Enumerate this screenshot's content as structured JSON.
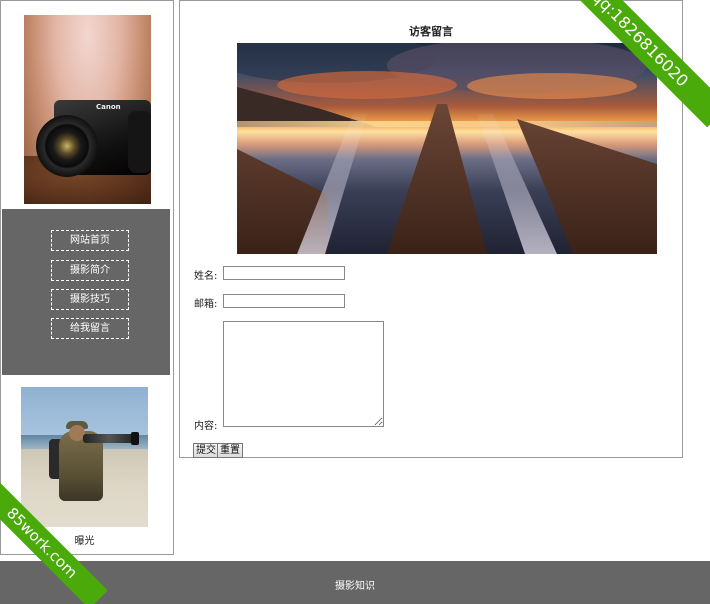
{
  "sidebar": {
    "nav": [
      {
        "label": "网站首页"
      },
      {
        "label": "摄影简介"
      },
      {
        "label": "摄影技巧"
      },
      {
        "label": "给我留言"
      }
    ],
    "camera_brand": "Canon",
    "photographer_caption": "曝光"
  },
  "main": {
    "title": "访客留言",
    "form": {
      "name_label": "姓名:",
      "email_label": "邮箱:",
      "content_label": "内容:",
      "name_value": "",
      "email_value": "",
      "content_value": "",
      "submit_label": "提交",
      "reset_label": "重置"
    }
  },
  "footer": {
    "text": "摄影知识"
  },
  "watermarks": {
    "top_right": "qq:1826816020",
    "bottom_left": "85work.com"
  },
  "colors": {
    "nav_background": "#666666",
    "footer_background": "#666666",
    "ribbon": "#4aaa0a"
  }
}
